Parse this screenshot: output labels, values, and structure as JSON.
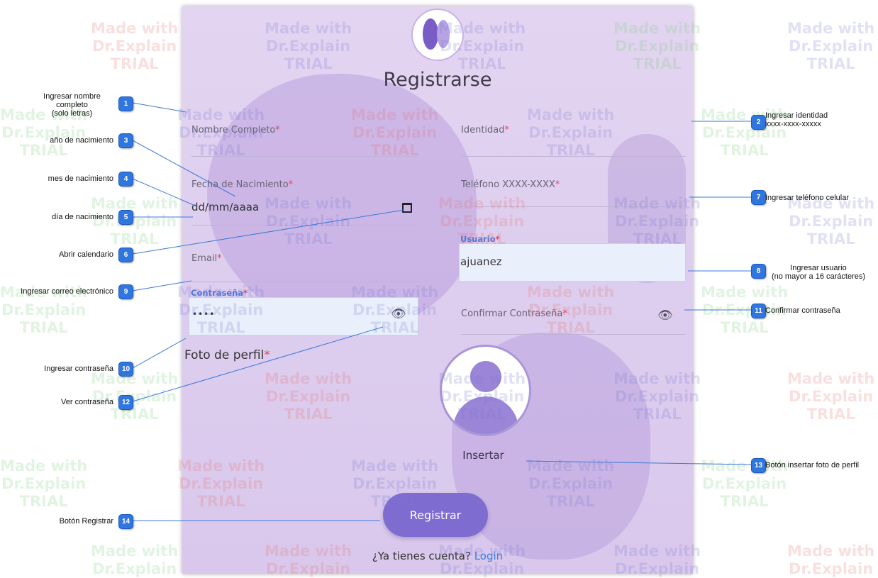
{
  "form": {
    "title": "Registrarse",
    "fields": {
      "nombre": {
        "label": "Nombre Completo",
        "required": "*"
      },
      "identidad": {
        "label": "Identidad",
        "required": "*"
      },
      "fecha": {
        "label": "Fecha de Nacimiento",
        "required": "*",
        "value": "dd/mm/aaaa"
      },
      "telefono": {
        "label": "Teléfono XXXX-XXXX",
        "required": "*"
      },
      "email": {
        "label": "Email",
        "required": "*"
      },
      "usuario": {
        "label": "Usuario",
        "required": "*",
        "value": "ajuanez"
      },
      "contrasena": {
        "label": "Contraseña",
        "required": "*",
        "value": "••••"
      },
      "confirmar": {
        "label": "Confirmar Contraseña",
        "required": "*"
      }
    },
    "foto": {
      "label": "Foto de perfil",
      "required": "*"
    },
    "insertar_label": "Insertar",
    "registrar_label": "Registrar",
    "login_prompt": "¿Ya tienes cuenta?",
    "login_link": "Login"
  },
  "icons": {
    "calendar": "calendar-icon",
    "eye": "eye-icon",
    "avatar": "avatar-placeholder"
  },
  "colors": {
    "accent": "#7f6cd0",
    "required": "#e84464",
    "link": "#3d7de0",
    "badge": "#2f76de"
  },
  "watermark": {
    "line1": "Made with",
    "line2": "Dr.Explain",
    "line3": "TRIAL"
  },
  "callouts": [
    {
      "n": "1",
      "text": "Ingresar nombre completo\n(solo letras)"
    },
    {
      "n": "2",
      "text": "Ingresar identidad\nxxxx-xxxx-xxxxx"
    },
    {
      "n": "3",
      "text": "año de nacimiento"
    },
    {
      "n": "4",
      "text": "mes de nacimiento"
    },
    {
      "n": "5",
      "text": "día de nacimiento"
    },
    {
      "n": "6",
      "text": "Abrir calendario"
    },
    {
      "n": "7",
      "text": "Ingresar teléfono celular"
    },
    {
      "n": "8",
      "text": "Ingresar usuario\n(no mayor a 16 carácteres)"
    },
    {
      "n": "9",
      "text": "Ingresar correo electrónico"
    },
    {
      "n": "10",
      "text": "Ingresar contraseña"
    },
    {
      "n": "11",
      "text": "Confirmar contraseña"
    },
    {
      "n": "12",
      "text": "Ver contraseña"
    },
    {
      "n": "13",
      "text": "Botón insertar foto de perfil"
    },
    {
      "n": "14",
      "text": "Botón Registrar"
    }
  ]
}
